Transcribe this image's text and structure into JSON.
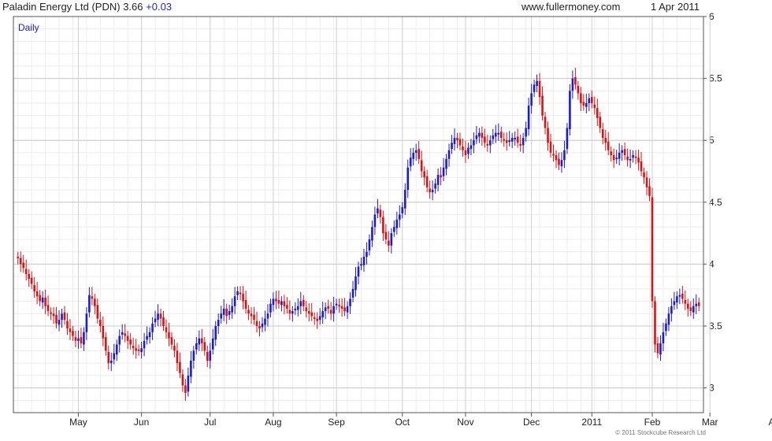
{
  "header": {
    "title": "Paladin Energy Ltd (PDN)",
    "price": "3.66",
    "change": "+0.03",
    "site": "www.fullermoney.com",
    "date": "1 Apr 2011"
  },
  "footer": {
    "copyright": "© 2011 Stockcube Research Ltd"
  },
  "colors": {
    "up": "#1a1adb",
    "down": "#e01010",
    "grid": "#d8d8d8",
    "axis": "#555555",
    "label": "#1a1adb"
  },
  "chart_data": {
    "type": "candlestick",
    "period_label": "Daily",
    "ylim": [
      2.8,
      6.0
    ],
    "y_ticks": [
      3,
      3.5,
      4,
      4.5,
      5,
      5.5,
      6
    ],
    "y_tick_labels": [
      "3",
      "3.5",
      "4",
      "4.5",
      "5",
      "5.5",
      "6"
    ],
    "x_ticks": [
      "May",
      "Jun",
      "Jul",
      "Aug",
      "Sep",
      "Oct",
      "Nov",
      "Dec",
      "2011",
      "Feb",
      "Mar",
      "Apr"
    ],
    "x_tick_index": [
      22,
      45,
      70,
      93,
      116,
      140,
      163,
      187,
      209,
      231,
      252,
      276
    ],
    "series_close": [
      4.05,
      4.0,
      3.97,
      3.92,
      3.88,
      3.84,
      3.78,
      3.74,
      3.7,
      3.73,
      3.66,
      3.62,
      3.6,
      3.58,
      3.52,
      3.55,
      3.6,
      3.55,
      3.48,
      3.45,
      3.42,
      3.38,
      3.4,
      3.36,
      3.45,
      3.6,
      3.75,
      3.72,
      3.66,
      3.56,
      3.5,
      3.4,
      3.3,
      3.2,
      3.22,
      3.28,
      3.35,
      3.42,
      3.45,
      3.42,
      3.38,
      3.35,
      3.32,
      3.3,
      3.3,
      3.32,
      3.38,
      3.42,
      3.45,
      3.52,
      3.56,
      3.6,
      3.56,
      3.5,
      3.45,
      3.4,
      3.35,
      3.3,
      3.2,
      3.12,
      3.02,
      2.96,
      3.1,
      3.22,
      3.3,
      3.36,
      3.4,
      3.36,
      3.3,
      3.22,
      3.3,
      3.4,
      3.5,
      3.55,
      3.6,
      3.64,
      3.58,
      3.62,
      3.66,
      3.74,
      3.78,
      3.76,
      3.7,
      3.64,
      3.6,
      3.58,
      3.55,
      3.5,
      3.48,
      3.52,
      3.56,
      3.6,
      3.68,
      3.72,
      3.7,
      3.68,
      3.7,
      3.66,
      3.64,
      3.6,
      3.62,
      3.64,
      3.66,
      3.7,
      3.66,
      3.62,
      3.6,
      3.58,
      3.56,
      3.54,
      3.58,
      3.62,
      3.65,
      3.64,
      3.6,
      3.66,
      3.68,
      3.66,
      3.64,
      3.62,
      3.66,
      3.72,
      3.8,
      3.9,
      3.98,
      4.0,
      4.06,
      4.1,
      4.2,
      4.3,
      4.4,
      4.45,
      4.38,
      4.25,
      4.2,
      4.15,
      4.25,
      4.3,
      4.36,
      4.4,
      4.46,
      4.6,
      4.78,
      4.86,
      4.9,
      4.92,
      4.85,
      4.75,
      4.7,
      4.62,
      4.58,
      4.6,
      4.65,
      4.72,
      4.7,
      4.78,
      4.85,
      4.92,
      4.98,
      5.02,
      5.0,
      4.96,
      4.92,
      4.88,
      4.94,
      4.96,
      5.0,
      5.04,
      5.06,
      5.02,
      4.98,
      4.96,
      5.0,
      5.04,
      5.06,
      5.06,
      5.02,
      5.0,
      4.98,
      5.0,
      5.02,
      5.02,
      4.98,
      4.96,
      5.02,
      5.1,
      5.28,
      5.38,
      5.45,
      5.48,
      5.35,
      5.2,
      5.1,
      4.98,
      4.9,
      4.88,
      4.84,
      4.8,
      4.84,
      4.92,
      5.1,
      5.4,
      5.5,
      5.45,
      5.38,
      5.3,
      5.28,
      5.3,
      5.34,
      5.3,
      5.26,
      5.18,
      5.1,
      5.02,
      4.98,
      4.92,
      4.88,
      4.84,
      4.86,
      4.9,
      4.92,
      4.88,
      4.84,
      4.85,
      4.88,
      4.86,
      4.82,
      4.75,
      4.7,
      4.62,
      4.55,
      3.7,
      3.35,
      3.28,
      3.36,
      3.45,
      3.52,
      3.6,
      3.66,
      3.7,
      3.74,
      3.75,
      3.72,
      3.68,
      3.64,
      3.62,
      3.66,
      3.68,
      3.66
    ]
  }
}
